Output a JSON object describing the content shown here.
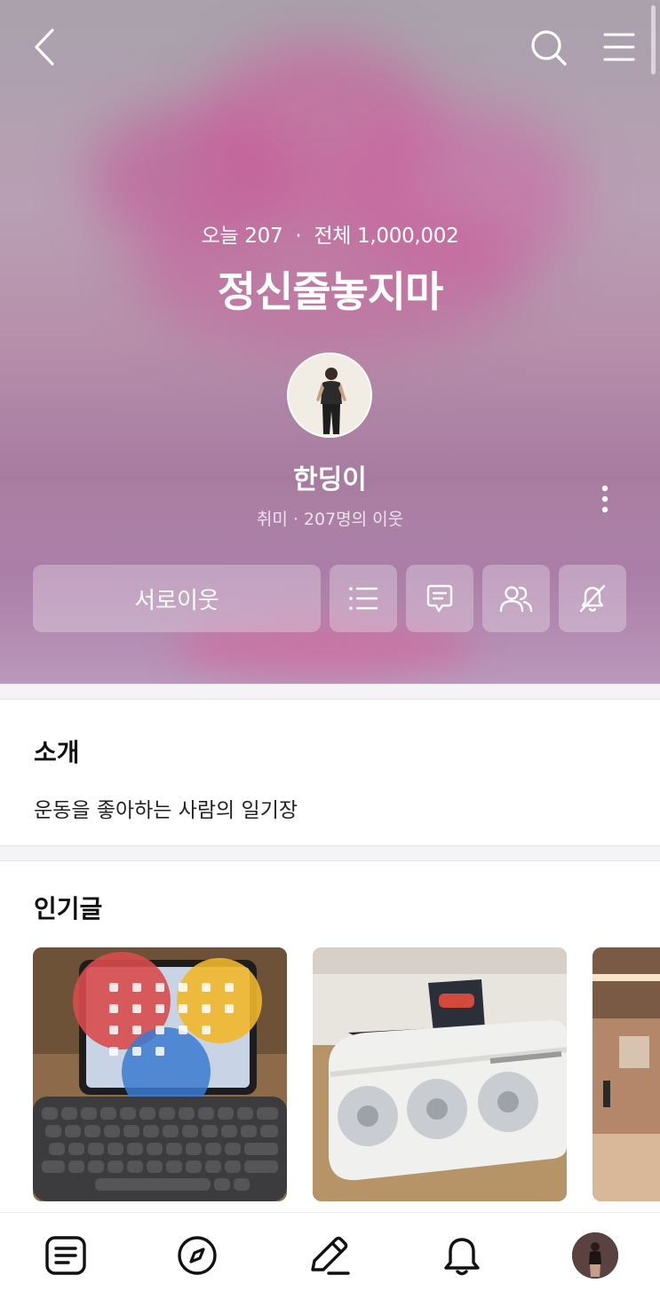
{
  "blog": {
    "today_label": "오늘 207",
    "total_label": "전체 1,000,002",
    "title": "정신줄놓지마",
    "nickname": "한딩이",
    "category": "취미",
    "neighbors": "207명의 이웃"
  },
  "actions": {
    "neighbor_label": "서로이웃"
  },
  "intro": {
    "title": "소개",
    "text": "운동을 좋아하는 사람의 일기장"
  },
  "popular": {
    "title": "인기글",
    "items": [
      {
        "thumbnail": "tablet-keyboard-photo"
      },
      {
        "thumbnail": "gpu-box-photo"
      },
      {
        "thumbnail": "gym-interior-photo"
      }
    ]
  },
  "icons": {
    "back": "back-icon",
    "search": "search-icon",
    "menu": "menu-icon",
    "more": "more-vertical-icon",
    "post_list": "list-icon",
    "guestbook": "chat-icon",
    "neighbors": "users-icon",
    "alarm_off": "bell-off-icon",
    "nav_feed": "feed-icon",
    "nav_discover": "compass-icon",
    "nav_write": "pencil-icon",
    "nav_alerts": "bell-icon"
  },
  "colors": {
    "hero_overlay": "#b690ab",
    "cloud_pink": "#c85a96",
    "text_primary": "#111111"
  }
}
